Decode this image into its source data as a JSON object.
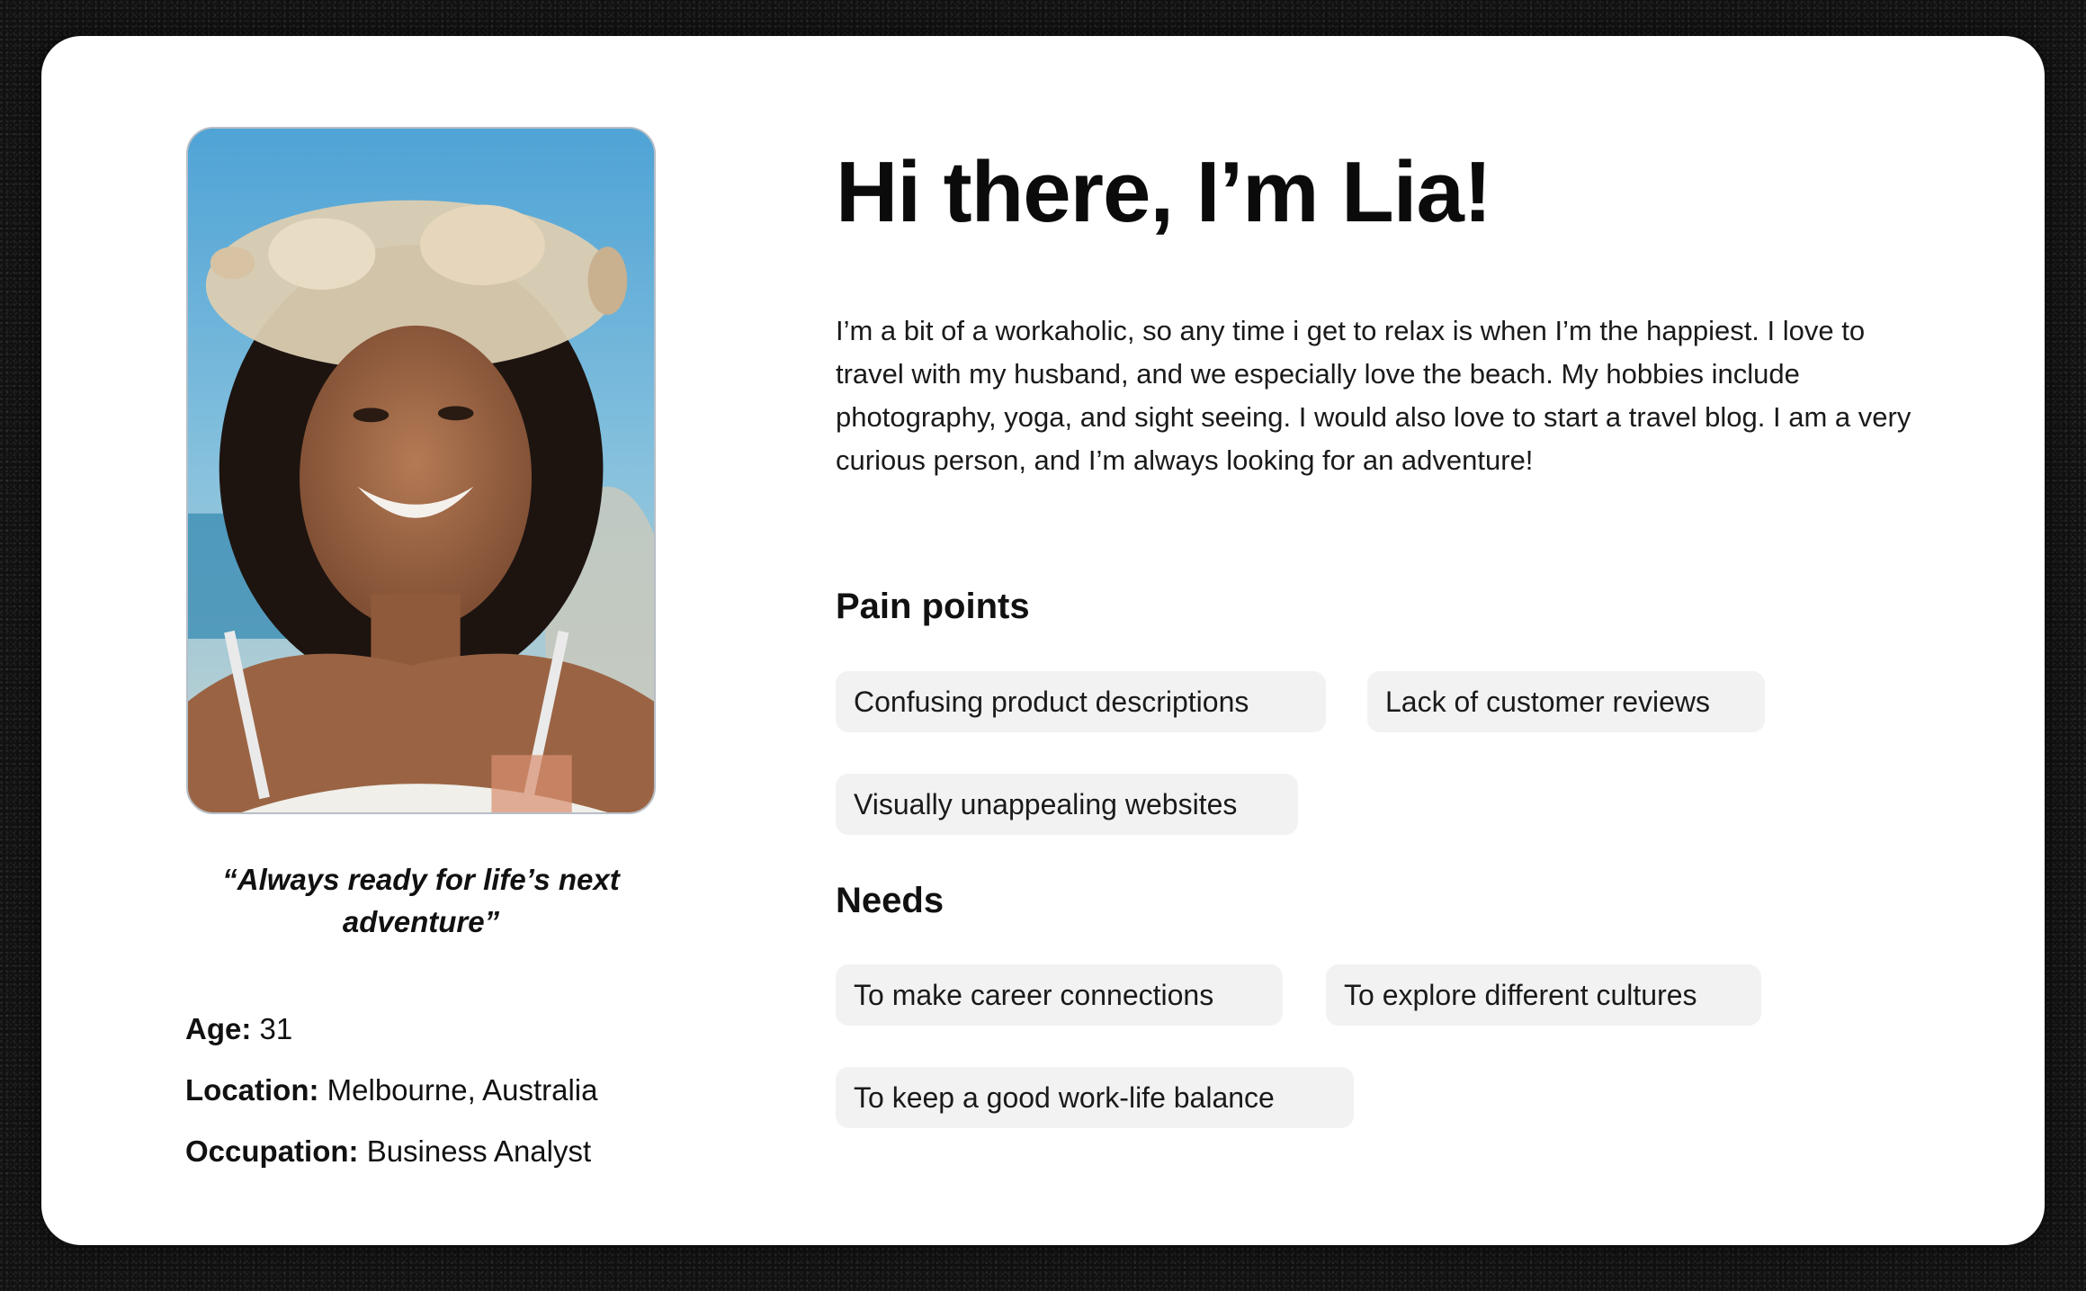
{
  "persona": {
    "quote": "“Always ready for life’s next adventure”",
    "facts": {
      "age": {
        "label": "Age:",
        "value": "31"
      },
      "location": {
        "label": "Location:",
        "value": "Melbourne, Australia"
      },
      "occupation": {
        "label": "Occupation:",
        "value": "Business Analyst"
      }
    },
    "headline": "Hi there, I’m Lia!",
    "bio": "I’m a bit of a workaholic, so any time i get to relax is when I’m the happiest. I love to travel with my husband, and we especially love the beach. My hobbies include photography, yoga, and sight seeing. I would also love to start a travel blog. I am a very curious person, and I’m always looking for an adventure!",
    "pain_points": {
      "heading": "Pain points",
      "items": [
        "Confusing product descriptions",
        "Lack of customer reviews",
        "Visually unappealing websites"
      ]
    },
    "needs": {
      "heading": "Needs",
      "items": [
        "To make career connections",
        "To explore different cultures",
        "To keep a good work-life balance"
      ]
    }
  },
  "colors": {
    "card_background": "#ffffff",
    "chip_background": "#f2f2f2",
    "text": "#111111",
    "backdrop": "#111111"
  }
}
